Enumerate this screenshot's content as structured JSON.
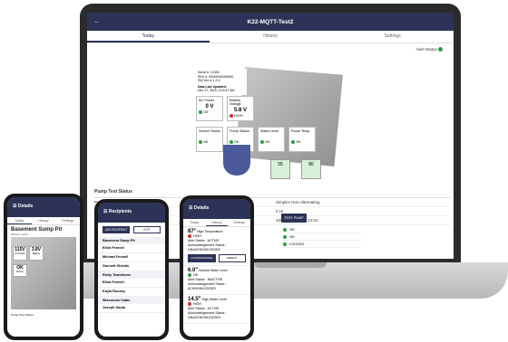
{
  "laptop": {
    "app_title": "K22-MQTT-Test2",
    "tabs": [
      "Today",
      "History",
      "Settings"
    ],
    "alert_status_label": "Alert Status",
    "info": {
      "serial": "Serial #: 12345",
      "line2": "SKU #: 00000000000000",
      "line3": "SW Ver #: 1.0.0",
      "updated_label": "Data Last Updated:",
      "updated_value": "Dec 27, 2019, 3:15:47 AM"
    },
    "tiles": [
      {
        "label": "AC Power",
        "value": "0 V",
        "status": "OK",
        "color": "green"
      },
      {
        "label": "Battery Voltage",
        "value": "5.8 V",
        "status": "HIGH",
        "color": "red"
      },
      {
        "label": "Sensor Status",
        "value": "",
        "status": "OK",
        "color": "green"
      },
      {
        "label": "Pump Status",
        "value": "",
        "status": "OK",
        "color": "green"
      },
      {
        "label": "Water Level",
        "value": "",
        "status": "OK",
        "color": "green"
      },
      {
        "label": "Room Temp.",
        "value": "",
        "status": "OK",
        "color": "green"
      }
    ],
    "gauges": [
      "55",
      "86"
    ],
    "pump_test": {
      "title": "Pump Test Status",
      "rows": [
        {
          "label": "Pump Mode",
          "value": "Simplex Non-Alternating"
        },
        {
          "label": "",
          "value": "0 Hr"
        },
        {
          "label": "",
          "value": "10/30/2019 at 14:13:31"
        }
      ],
      "button": "TEST PUMP"
    },
    "statuses": [
      {
        "text": "OK",
        "color": "green"
      },
      {
        "text": "OK",
        "color": "green"
      },
      {
        "text": "LOCKED",
        "color": "green"
      }
    ]
  },
  "phone1": {
    "header": "Details",
    "tabs": [
      "Today",
      "History",
      "Settings"
    ],
    "title": "Basement Sump Pit",
    "sub1": "Serial #: 1234",
    "tiles": [
      {
        "value": "115V",
        "label": "AC Power"
      },
      {
        "value": "3.8V",
        "label": "Battery"
      },
      {
        "value": "OK",
        "label": "Sensor"
      }
    ],
    "footer": "Pump Test Status"
  },
  "phone2": {
    "header": "Recipients",
    "buttons": [
      "ADD RECIPIENT",
      "EDIT"
    ],
    "groups": [
      {
        "name": "Basement Sump Pit",
        "people": [
          "Elliot Fennell",
          "Michael Fennell",
          "Gunnett Shields"
        ]
      },
      {
        "name": "Ricky Townhome",
        "people": [
          "Elliot Fennell",
          "Kayla Rooney"
        ]
      },
      {
        "name": "Wisconsin Cabin",
        "people": [
          "Joseph Gauto"
        ]
      }
    ]
  },
  "phone3": {
    "header": "Details",
    "tabs": [
      "Today",
      "History",
      "Settings"
    ],
    "items": [
      {
        "value": "87°",
        "label": "High Temperature",
        "status": "HIGH",
        "color": "red",
        "alert": "ACTIVE",
        "ack": "UNACKNOWLEDGED"
      },
      {
        "value": "6.0\"",
        "label": "Normal Water Level",
        "status": "OK",
        "color": "green",
        "alert": "INACTIVE",
        "ack": "ACKNOWLEDGED"
      },
      {
        "value": "14.5\"",
        "label": "High Water Level",
        "status": "HIGH",
        "color": "red",
        "alert": "ACTIVE",
        "ack": "UNACKNOWLEDGED"
      }
    ],
    "alert_label": "Alert Status",
    "ack_label": "Acknowledgement Status",
    "ack_buttons": [
      "ACKNOWLEDGE",
      "DIRECT"
    ]
  },
  "colors": {
    "primary": "#2c3357",
    "ok": "#2e9b45",
    "high": "#d0312d"
  }
}
